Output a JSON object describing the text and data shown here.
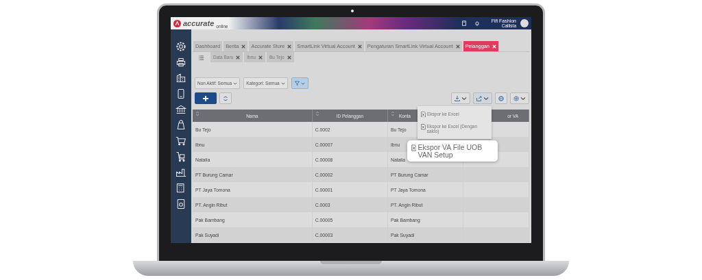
{
  "topbar": {
    "logo": "accurate",
    "logo_sub": "online",
    "company": "Fifi Fashion",
    "user": "Callista"
  },
  "tabs": [
    {
      "label": "Dashboard",
      "closable": false,
      "selected": false
    },
    {
      "label": "Berita",
      "closable": true,
      "selected": false
    },
    {
      "label": "Accurate Store",
      "closable": true,
      "selected": false
    },
    {
      "label": "SmartLink Virtual Account",
      "closable": true,
      "selected": false
    },
    {
      "label": "Pengaturan SmartLink Virtual Account",
      "closable": true,
      "selected": false
    },
    {
      "label": "Pelanggan",
      "closable": true,
      "selected": true
    }
  ],
  "subtabs": [
    {
      "label": "Data Baru",
      "selected": false
    },
    {
      "label": "Ibnu",
      "selected": false
    },
    {
      "label": "Bu Tejo",
      "selected": false
    }
  ],
  "filters": [
    {
      "label": "Non Aktif: Semua"
    },
    {
      "label": "Kategori: Semua"
    }
  ],
  "filter_button": {
    "active": true
  },
  "table": {
    "columns": [
      "Nama",
      "ID Pelanggan",
      "Konta",
      "or VA"
    ],
    "rows": [
      [
        "Bu Tejo",
        "C.0002",
        "Bu Tejo"
      ],
      [
        "Ibnu",
        "C.00007",
        "Ibnu"
      ],
      [
        "Natalia",
        "C.00008",
        "Natalia"
      ],
      [
        "PT Burung Camar",
        "C.00002",
        "PT Burung Camar"
      ],
      [
        "PT Jaya Tomona",
        "C.00001",
        "PT Jaya Tomona"
      ],
      [
        "PT. Angin Ribut",
        "C.0003",
        "PT. Angin Ribut"
      ],
      [
        "Pak Bambang",
        "C.00005",
        "Pak Bambang"
      ],
      [
        "Pak Suyadi",
        "C.00003",
        "Pak Suyadi"
      ]
    ]
  },
  "export_menu": [
    {
      "label": "Ekspor ke Excel",
      "highlighted": false
    },
    {
      "label": "Ekspor ke Excel (Dengan saldo)",
      "highlighted": false
    },
    {
      "label": "Ekspor VA File UOB VAN Setup",
      "highlighted": true
    }
  ]
}
